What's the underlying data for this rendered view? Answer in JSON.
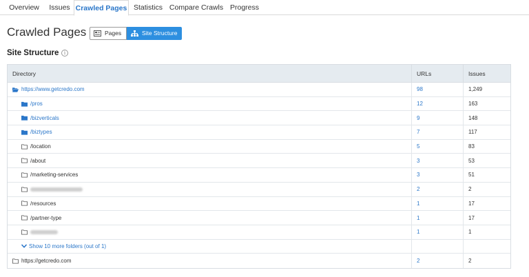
{
  "tabs": [
    {
      "label": "Overview",
      "active": false
    },
    {
      "label": "Issues",
      "active": false
    },
    {
      "label": "Crawled Pages",
      "active": true
    },
    {
      "label": "Statistics",
      "active": false
    },
    {
      "label": "Compare Crawls",
      "active": false
    },
    {
      "label": "Progress",
      "active": false
    }
  ],
  "header": {
    "title": "Crawled Pages",
    "view_toggle": {
      "pages_label": "Pages",
      "structure_label": "Site Structure",
      "selected": "Site Structure"
    }
  },
  "section": {
    "title": "Site Structure",
    "info_icon": "info-icon"
  },
  "table": {
    "columns": {
      "directory": "Directory",
      "urls": "URLs",
      "issues": "Issues"
    },
    "rows": [
      {
        "dir": "https://www.getcredo.com",
        "urls": "98",
        "issues": "1,249",
        "icon": "folder-open-icon"
      },
      {
        "dir": "/pros",
        "urls": "12",
        "issues": "163",
        "icon": "folder-filled-icon"
      },
      {
        "dir": "/bizverticals",
        "urls": "9",
        "issues": "148",
        "icon": "folder-filled-icon"
      },
      {
        "dir": "/biztypes",
        "urls": "7",
        "issues": "117",
        "icon": "folder-filled-icon"
      },
      {
        "dir": "/location",
        "urls": "5",
        "issues": "83",
        "icon": "folder-outline-icon"
      },
      {
        "dir": "/about",
        "urls": "3",
        "issues": "53",
        "icon": "folder-outline-icon"
      },
      {
        "dir": "/marketing-services",
        "urls": "3",
        "issues": "51",
        "icon": "folder-outline-icon"
      },
      {
        "dir": "",
        "urls": "2",
        "issues": "2",
        "icon": "folder-outline-icon",
        "redacted": true
      },
      {
        "dir": "/resources",
        "urls": "1",
        "issues": "17",
        "icon": "folder-outline-icon"
      },
      {
        "dir": "/partner-type",
        "urls": "1",
        "issues": "17",
        "icon": "folder-outline-icon"
      },
      {
        "dir": "",
        "urls": "1",
        "issues": "1",
        "icon": "folder-outline-icon",
        "redacted": true
      }
    ],
    "show_more": "Show 10 more folders (out of 1)",
    "footer_row": {
      "dir": "https://getcredo.com",
      "urls": "2",
      "issues": "2",
      "icon": "folder-outline-icon"
    }
  },
  "colors": {
    "accent": "#2b77c9",
    "toggle_active": "#2d8fe0",
    "header_bg": "#e5ebf0"
  }
}
